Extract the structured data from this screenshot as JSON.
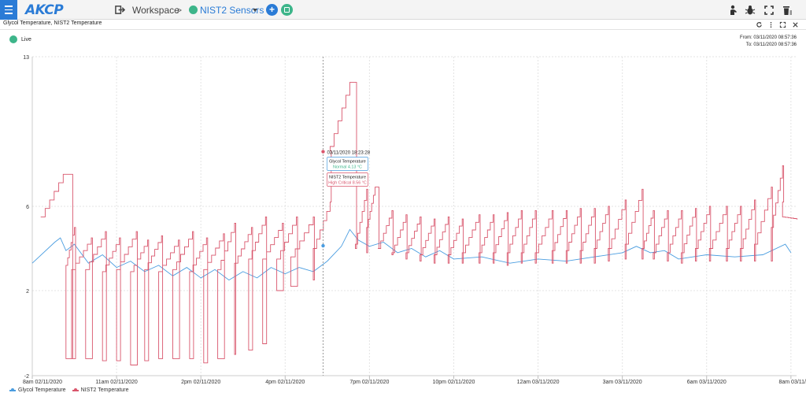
{
  "app": {
    "logo": "AKCP"
  },
  "header": {
    "workspace_label": "Workspace",
    "separator": ">",
    "sensors_label": "NIST2 Sensors",
    "add_symbol": "+",
    "status_color": "#3db58a"
  },
  "toolbar_icons": [
    "person-icon",
    "bug-icon",
    "fullscreen-icon",
    "trash-icon"
  ],
  "panel": {
    "title": "Glycol Temperature, NIST2 Temperature",
    "icons": [
      "refresh-icon",
      "more-icon",
      "expand-icon",
      "close-icon"
    ]
  },
  "live": {
    "label": "Live"
  },
  "range": {
    "from": "From: 03/11/2020 08:57:36",
    "to": "To: 03/11/2020 08:57:36"
  },
  "tooltip": {
    "timestamp": "03/11/2020 18:23:28",
    "glycol_title": "Glycol Temperature",
    "glycol_value": "Normal 4.13 °C",
    "nist_title": "NIST2 Temperature",
    "nist_value": "High Critical 8.56 °C"
  },
  "chart_data": {
    "type": "line",
    "title": "",
    "xlabel": "",
    "ylabel": "",
    "y_ticks": [
      "13",
      "6",
      "2",
      "-2"
    ],
    "ylim": [
      -2,
      13
    ],
    "y_scale": "piecewise",
    "grid": true,
    "legend": "bottom-left",
    "x_ticks": [
      "8am 02/11/2020",
      "11am 02/11/2020",
      "2pm 02/11/2020",
      "4pm 02/11/2020",
      "7pm 02/11/2020",
      "10pm 02/11/2020",
      "12am 03/11/2020",
      "3am 03/11/2020",
      "6am 03/11/2020",
      "8am 03/11/"
    ],
    "x_hours": [
      0,
      3,
      6,
      9,
      12,
      15,
      18,
      21,
      24,
      27
    ],
    "xlim": [
      0,
      27.2
    ],
    "series": [
      {
        "name": "Glycol Temperature",
        "color": "#4a9de0",
        "points": [
          [
            0.0,
            3.3
          ],
          [
            0.8,
            4.3
          ],
          [
            1.0,
            4.5
          ],
          [
            1.2,
            3.9
          ],
          [
            1.5,
            4.2
          ],
          [
            2.0,
            3.3
          ],
          [
            2.5,
            3.7
          ],
          [
            3.0,
            3.1
          ],
          [
            3.5,
            3.4
          ],
          [
            4.0,
            2.9
          ],
          [
            4.5,
            3.2
          ],
          [
            5.0,
            2.7
          ],
          [
            5.5,
            3.1
          ],
          [
            6.0,
            2.6
          ],
          [
            6.5,
            3.0
          ],
          [
            7.0,
            2.5
          ],
          [
            7.5,
            2.9
          ],
          [
            8.0,
            2.6
          ],
          [
            8.5,
            3.1
          ],
          [
            9.0,
            2.8
          ],
          [
            9.5,
            3.1
          ],
          [
            10.0,
            2.9
          ],
          [
            10.5,
            3.4
          ],
          [
            11.0,
            4.1
          ],
          [
            11.3,
            4.9
          ],
          [
            11.6,
            4.4
          ],
          [
            12.0,
            4.1
          ],
          [
            12.5,
            4.3
          ],
          [
            13.0,
            3.8
          ],
          [
            13.5,
            4.0
          ],
          [
            14.0,
            3.6
          ],
          [
            14.5,
            3.9
          ],
          [
            15.0,
            3.5
          ],
          [
            16.0,
            3.6
          ],
          [
            17.0,
            3.3
          ],
          [
            18.0,
            3.5
          ],
          [
            19.0,
            3.4
          ],
          [
            20.0,
            3.6
          ],
          [
            21.0,
            3.8
          ],
          [
            21.5,
            4.1
          ],
          [
            22.0,
            3.8
          ],
          [
            22.5,
            3.9
          ],
          [
            23.0,
            3.5
          ],
          [
            24.0,
            3.7
          ],
          [
            25.0,
            3.6
          ],
          [
            26.0,
            3.7
          ],
          [
            26.8,
            4.2
          ],
          [
            27.0,
            3.8
          ]
        ]
      },
      {
        "name": "NIST2 Temperature",
        "color": "#d9566c",
        "teeth": [
          [
            0.1,
            0.3,
            1.1,
            5.5,
            1.4,
            7.5,
            -1.2
          ],
          [
            1.0,
            1.2,
            1.5,
            3.2,
            1.5,
            5.0,
            -1.2
          ],
          [
            1.6,
            1.4,
            2.1,
            3.0,
            2.1,
            4.5,
            -1.2
          ],
          [
            2.1,
            1.9,
            2.6,
            3.0,
            2.6,
            4.8,
            -1.3
          ],
          [
            2.7,
            2.5,
            3.1,
            2.9,
            3.1,
            4.5,
            -1.3
          ],
          [
            3.2,
            3.0,
            3.7,
            3.0,
            3.7,
            4.8,
            -1.5
          ],
          [
            3.7,
            3.5,
            4.1,
            2.9,
            4.1,
            4.4,
            -1.3
          ],
          [
            4.3,
            4.0,
            4.6,
            3.0,
            4.6,
            4.6,
            -1.2
          ],
          [
            4.8,
            4.5,
            5.2,
            2.9,
            5.2,
            4.4,
            -1.2
          ],
          [
            5.3,
            5.0,
            5.7,
            3.0,
            5.7,
            4.8,
            -1.2
          ],
          [
            5.8,
            5.6,
            6.2,
            2.9,
            6.2,
            4.5,
            -1.4
          ],
          [
            6.3,
            6.1,
            6.8,
            3.0,
            6.8,
            4.7,
            -1.2
          ],
          [
            6.9,
            6.6,
            7.2,
            3.0,
            7.2,
            5.2,
            -1.0
          ],
          [
            7.4,
            7.2,
            7.8,
            3.3,
            7.8,
            5.0,
            -0.8
          ],
          [
            7.9,
            7.7,
            8.3,
            3.5,
            8.3,
            5.5,
            -0.5
          ],
          [
            8.5,
            8.2,
            8.9,
            3.5,
            8.9,
            5.2,
            2.0
          ],
          [
            9.0,
            8.7,
            9.4,
            3.5,
            9.4,
            5.5,
            2.2
          ],
          [
            9.5,
            9.2,
            10.0,
            3.6,
            10.0,
            5.5,
            2.5
          ],
          [
            10.2,
            10.0,
            10.6,
            4.0,
            10.6,
            6.2,
            8.6
          ],
          [
            10.8,
            10.6,
            11.3,
            8.8,
            11.5,
            11.8,
            4.0
          ],
          [
            11.6,
            11.5,
            11.9,
            4.2,
            11.9,
            6.8,
            3.8
          ],
          [
            12.0,
            11.9,
            12.2,
            5.0,
            12.3,
            6.9,
            4.0
          ],
          [
            12.4,
            12.3,
            12.8,
            4.0,
            12.8,
            5.8,
            3.7
          ],
          [
            12.9,
            12.8,
            13.3,
            3.8,
            13.3,
            5.6,
            3.5
          ],
          [
            13.4,
            13.3,
            13.8,
            3.8,
            13.8,
            5.5,
            3.4
          ],
          [
            14.0,
            13.8,
            14.3,
            3.7,
            14.3,
            5.4,
            3.3
          ],
          [
            14.5,
            14.3,
            14.8,
            3.7,
            14.8,
            5.5,
            3.3
          ],
          [
            15.0,
            14.8,
            15.3,
            3.7,
            15.3,
            5.4,
            3.3
          ],
          [
            15.5,
            15.3,
            15.9,
            3.8,
            15.9,
            5.6,
            3.3
          ],
          [
            16.0,
            15.9,
            16.4,
            3.8,
            16.4,
            5.6,
            3.3
          ],
          [
            16.5,
            16.4,
            16.9,
            3.8,
            16.9,
            5.7,
            3.2
          ],
          [
            17.0,
            16.9,
            17.4,
            3.8,
            17.4,
            5.8,
            3.3
          ],
          [
            17.5,
            17.4,
            17.9,
            3.8,
            17.9,
            5.8,
            3.3
          ],
          [
            18.0,
            17.9,
            18.5,
            3.8,
            18.5,
            5.8,
            3.3
          ],
          [
            18.6,
            18.5,
            19.0,
            3.9,
            19.0,
            5.8,
            3.3
          ],
          [
            19.1,
            19.0,
            19.5,
            3.9,
            19.5,
            5.9,
            3.3
          ],
          [
            19.6,
            19.5,
            20.0,
            3.9,
            20.0,
            5.9,
            3.3
          ],
          [
            20.1,
            20.0,
            20.5,
            4.0,
            20.5,
            6.0,
            3.4
          ],
          [
            20.6,
            20.5,
            21.1,
            4.0,
            21.1,
            6.3,
            3.5
          ],
          [
            21.2,
            21.1,
            21.7,
            4.2,
            21.7,
            6.8,
            3.5
          ],
          [
            21.9,
            21.7,
            22.1,
            4.0,
            22.1,
            5.8,
            3.5
          ],
          [
            22.3,
            22.1,
            22.6,
            3.8,
            22.6,
            5.8,
            3.4
          ],
          [
            22.8,
            22.6,
            23.1,
            3.8,
            23.1,
            5.8,
            3.3
          ],
          [
            23.3,
            23.1,
            23.6,
            3.8,
            23.6,
            5.9,
            3.4
          ],
          [
            23.8,
            23.6,
            24.1,
            4.0,
            24.1,
            6.0,
            3.4
          ],
          [
            24.3,
            24.1,
            24.7,
            4.0,
            24.7,
            6.0,
            3.4
          ],
          [
            24.9,
            24.7,
            25.2,
            4.0,
            25.2,
            6.0,
            3.4
          ],
          [
            25.4,
            25.2,
            25.7,
            4.0,
            25.7,
            6.3,
            3.4
          ],
          [
            25.9,
            25.7,
            26.3,
            4.2,
            26.3,
            6.9,
            3.4
          ],
          [
            26.5,
            26.3,
            26.7,
            5.0,
            26.7,
            7.9,
            6.2
          ],
          [
            26.9,
            26.7,
            27.2,
            5.5,
            27.2,
            5.4,
            5.4
          ]
        ]
      }
    ],
    "highlight": {
      "x": 10.35,
      "glycol": 4.13,
      "nist": 8.56
    }
  }
}
